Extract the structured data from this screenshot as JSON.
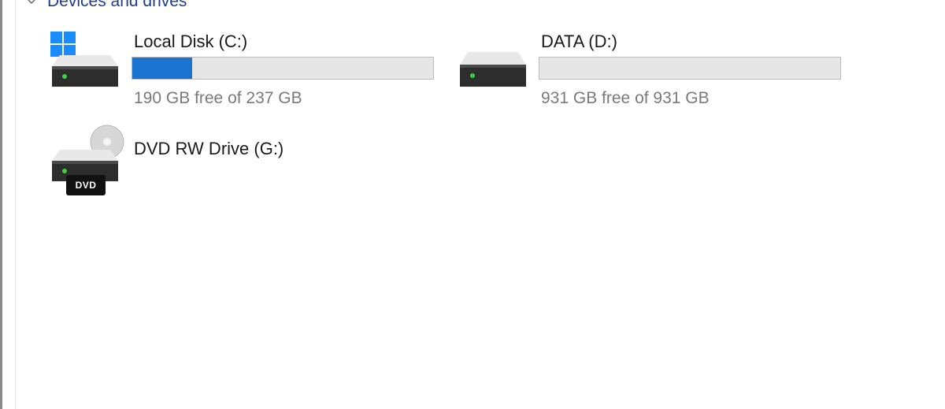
{
  "section": {
    "title": "Devices and drives"
  },
  "drives": [
    {
      "name": "Local Disk (C:)",
      "free_text": "190 GB free of 237 GB",
      "used_fraction": 0.198,
      "icon": "windows-system-drive-icon"
    },
    {
      "name": "DATA (D:)",
      "free_text": "931 GB free of 931 GB",
      "used_fraction": 0.0,
      "icon": "hard-drive-icon"
    },
    {
      "name": "DVD RW Drive (G:)",
      "badge": "DVD",
      "icon": "dvd-drive-icon"
    }
  ],
  "colors": {
    "section_title": "#1e3d8f",
    "bar_fill": "#1a73d0",
    "bar_track": "#e6e6e6",
    "led": "#3fd13f"
  }
}
